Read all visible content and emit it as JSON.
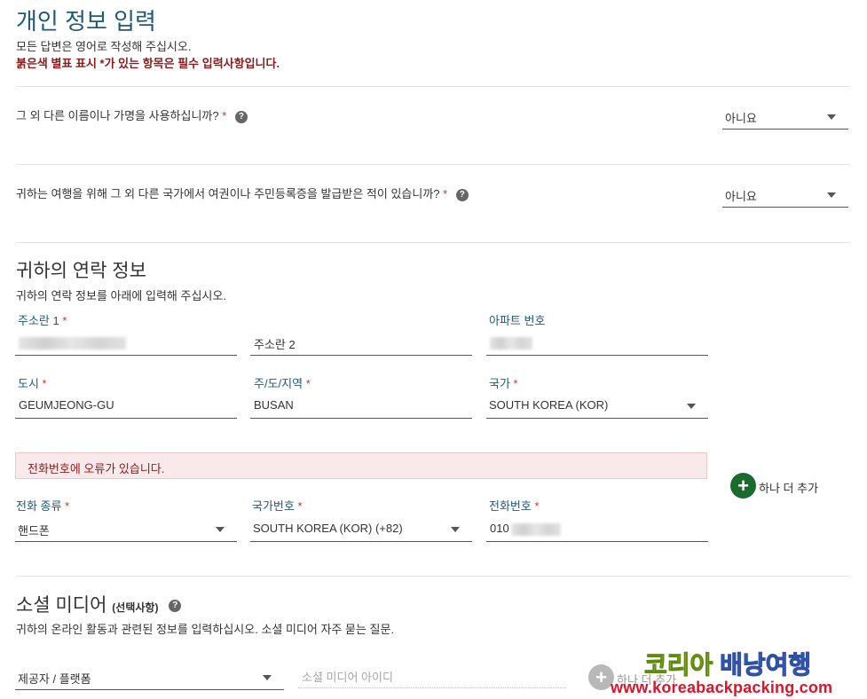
{
  "header": {
    "title": "개인 정보 입력",
    "subtitle": "모든 답변은 영어로 작성해 주십시오.",
    "required_note": "붉은색 별표 표시 *가 있는 항목은 필수 입력사항입니다."
  },
  "questions": [
    {
      "label": "그 외 다른 이름이나 가명을 사용하십니까?",
      "required": "*",
      "help": "?",
      "value": "아니요"
    },
    {
      "label": "귀하는 여행을 위해 그 외 다른 국가에서 여권이나 주민등록증을 발급받은 적이 있습니까?",
      "required": "*",
      "help": "?",
      "value": "아니요"
    }
  ],
  "contact": {
    "title": "귀하의 연락 정보",
    "subtitle": "귀하의 연락 정보를 아래에 입력해 주십시오.",
    "address1_label": "주소란 1",
    "address2_placeholder": "주소란 2",
    "apt_label": "아파트 번호",
    "city_label": "도시",
    "city_value": "GEUMJEONG-GU",
    "state_label": "주/도/지역",
    "state_value": "BUSAN",
    "country_label": "국가",
    "country_value": "SOUTH KOREA (KOR)",
    "error": "전화번호에 오류가 있습니다.",
    "phone_type_label": "전화 종류",
    "phone_type_value": "핸드폰",
    "country_code_label": "국가번호",
    "country_code_value": "SOUTH KOREA (KOR) (+82)",
    "phone_label": "전화번호",
    "phone_value": "010",
    "add_more": "하나 더 추가",
    "required": "*"
  },
  "social": {
    "title": "소셜 미디어",
    "optional": "(선택사항)",
    "help": "?",
    "subtitle": "귀하의 온라인 활동과 관련된 정보를 입력하십시오. 소셜 미디어 자주 묻는 질문.",
    "provider_placeholder": "제공자 / 플랫폼",
    "id_placeholder": "소셜 미디어 아이디",
    "add_more": "하나 더 추가"
  },
  "watermark": {
    "line1_a": "코리아",
    "line1_b": "배낭여행",
    "line2": "www.koreabackpacking.com"
  },
  "colors": {
    "title": "#1f5a78",
    "required_star": "#c0392b",
    "error_bg": "#f9e9ea",
    "add_button": "#1a6b2e"
  }
}
